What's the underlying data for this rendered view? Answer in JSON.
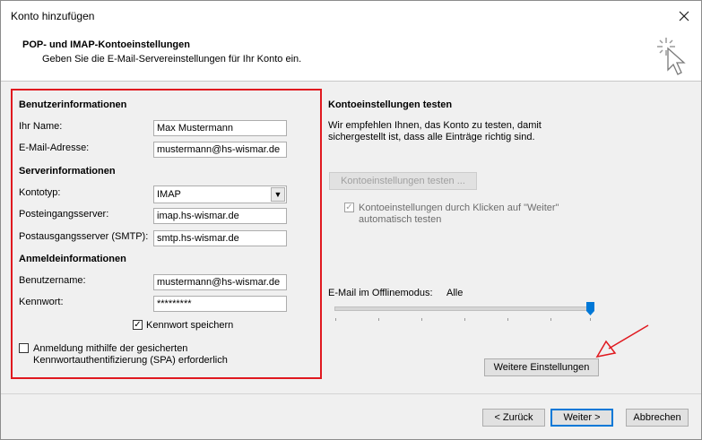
{
  "window": {
    "title": "Konto hinzufügen",
    "close_icon": "close-icon"
  },
  "header": {
    "title": "POP- und IMAP-Kontoeinstellungen",
    "subtitle": "Geben Sie die E-Mail-Servereinstellungen für Ihr Konto ein."
  },
  "user_info": {
    "heading": "Benutzerinformationen",
    "name_label": "Ihr Name:",
    "name_value": "Max Mustermann",
    "email_label": "E-Mail-Adresse:",
    "email_value": "mustermann@hs-wismar.de"
  },
  "server_info": {
    "heading": "Serverinformationen",
    "account_type_label": "Kontotyp:",
    "account_type_value": "IMAP",
    "incoming_label": "Posteingangsserver:",
    "incoming_value": "imap.hs-wismar.de",
    "outgoing_label": "Postausgangsserver (SMTP):",
    "outgoing_value": "smtp.hs-wismar.de"
  },
  "login_info": {
    "heading": "Anmeldeinformationen",
    "username_label": "Benutzername:",
    "username_value": "mustermann@hs-wismar.de",
    "password_label": "Kennwort:",
    "password_value": "*********",
    "save_password_label": "Kennwort speichern",
    "save_password_checked": true,
    "spa_label_line1": "Anmeldung mithilfe der gesicherten",
    "spa_label_line2": "Kennwortauthentifizierung (SPA) erforderlich",
    "spa_checked": false
  },
  "test": {
    "heading": "Kontoeinstellungen testen",
    "description_line1": "Wir empfehlen Ihnen, das Konto zu testen, damit",
    "description_line2": "sichergestellt ist, dass alle Einträge richtig sind.",
    "test_button": "Kontoeinstellungen testen ...",
    "auto_test_line1": "Kontoeinstellungen durch Klicken auf \"Weiter\"",
    "auto_test_line2": "automatisch testen",
    "auto_test_checked": true
  },
  "offline": {
    "label": "E-Mail im Offlinemodus:",
    "value": "Alle",
    "slider_level": 1.0
  },
  "more_settings_button": "Weitere Einstellungen",
  "footer": {
    "back_button": "< Zurück",
    "next_button": "Weiter >",
    "cancel_button": "Abbrechen"
  },
  "colors": {
    "highlight": "#e0191f",
    "accent": "#0078d7"
  }
}
